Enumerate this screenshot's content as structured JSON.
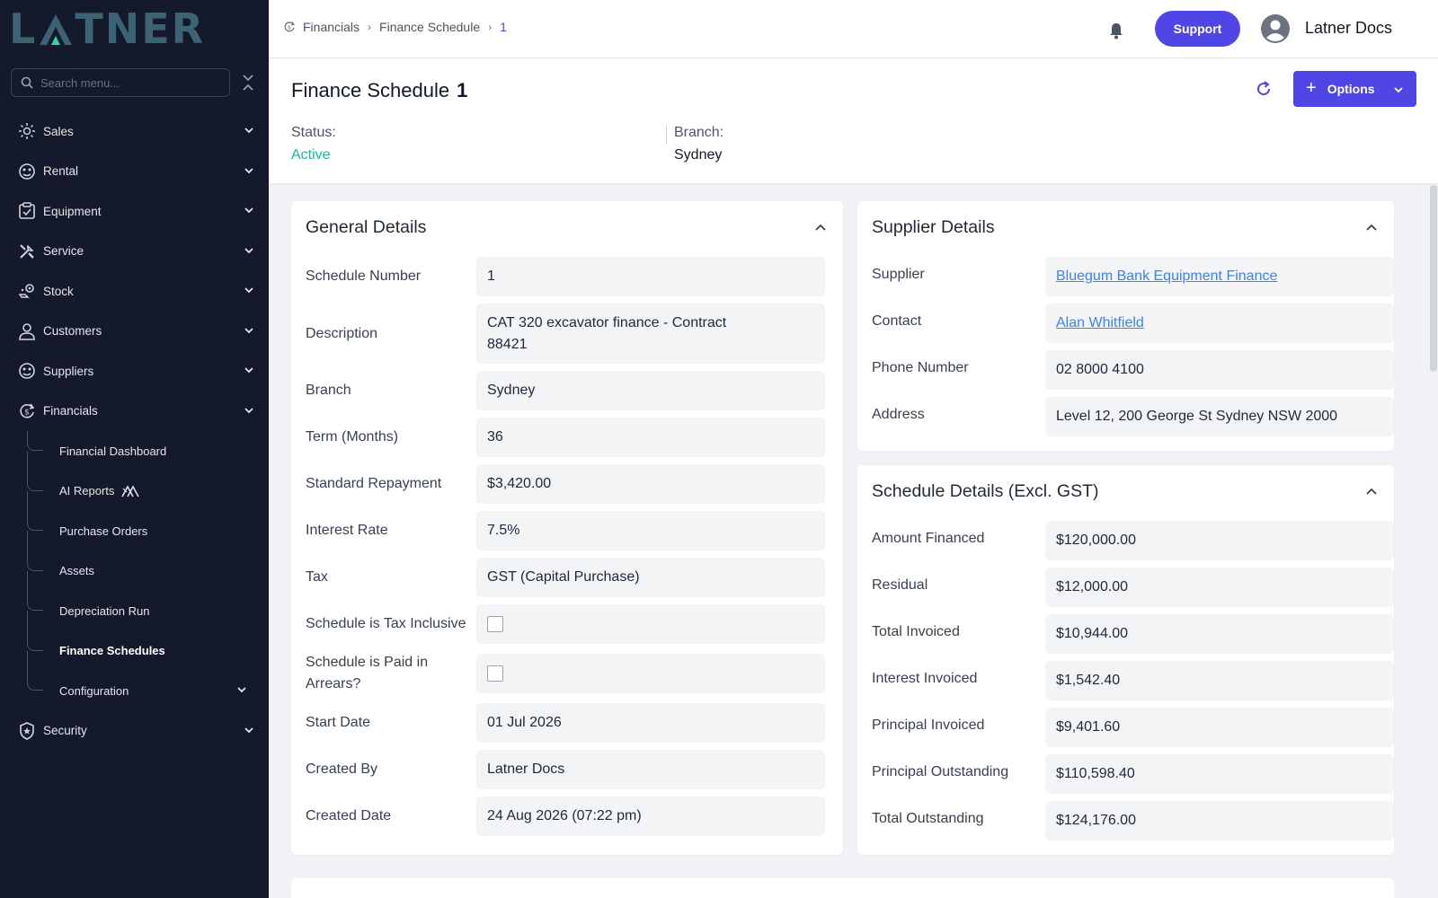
{
  "app": {
    "logo_text": "LATNER"
  },
  "sidebar": {
    "search_placeholder": "Search menu...",
    "items": [
      {
        "label": "Sales",
        "icon": "sales-icon"
      },
      {
        "label": "Rental",
        "icon": "rental-icon"
      },
      {
        "label": "Equipment",
        "icon": "equipment-icon"
      },
      {
        "label": "Service",
        "icon": "service-icon"
      },
      {
        "label": "Stock",
        "icon": "stock-icon"
      },
      {
        "label": "Customers",
        "icon": "customers-icon"
      },
      {
        "label": "Suppliers",
        "icon": "suppliers-icon"
      },
      {
        "label": "Financials",
        "icon": "financials-icon"
      }
    ],
    "financials_sub": [
      {
        "label": "Financial Dashboard"
      },
      {
        "label": "AI Reports"
      },
      {
        "label": "Purchase Orders"
      },
      {
        "label": "Assets"
      },
      {
        "label": "Depreciation Run"
      },
      {
        "label": "Finance Schedules"
      },
      {
        "label": "Configuration"
      }
    ],
    "security": {
      "label": "Security",
      "icon": "security-icon"
    }
  },
  "topbar": {
    "breadcrumb": [
      "Financials",
      "Finance Schedule",
      "1"
    ],
    "support_label": "Support",
    "user_name": "Latner Docs"
  },
  "header": {
    "title": "Finance Schedule",
    "record_number": "1",
    "options_label": "Options",
    "status_label": "Status:",
    "status_value": "Active",
    "branch_label": "Branch:",
    "branch_value": "Sydney"
  },
  "general": {
    "title": "General Details",
    "fields": [
      {
        "label": "Schedule Number",
        "value": "1"
      },
      {
        "label": "Description",
        "value": "CAT 320 excavator finance - Contract 88421"
      },
      {
        "label": "Branch",
        "value": "Sydney"
      },
      {
        "label": "Term (Months)",
        "value": "36"
      },
      {
        "label": "Standard Repayment",
        "value": "$3,420.00"
      },
      {
        "label": "Interest Rate",
        "value": "7.5%"
      },
      {
        "label": "Tax",
        "value": "GST (Capital Purchase)"
      },
      {
        "label": "Schedule is Tax Inclusive",
        "checked": false
      },
      {
        "label": "Schedule is Paid in Arrears?",
        "checked": false
      },
      {
        "label": "Start Date",
        "value": "01 Jul 2026"
      },
      {
        "label": "Created By",
        "value": "Latner Docs"
      },
      {
        "label": "Created Date",
        "value": "24 Aug 2026 (07:22 pm)"
      }
    ]
  },
  "supplier": {
    "title": "Supplier Details",
    "fields": [
      {
        "label": "Supplier",
        "value": "Bluegum Bank Equipment Finance"
      },
      {
        "label": "Contact",
        "value": "Alan Whitfield"
      },
      {
        "label": "Phone Number",
        "value": "02 8000 4100"
      },
      {
        "label": "Address",
        "value": "Level 12, 200 George St Sydney NSW 2000"
      }
    ]
  },
  "schedule": {
    "title": "Schedule Details (Excl. GST)",
    "fields": [
      {
        "label": "Amount Financed",
        "value": "$120,000.00"
      },
      {
        "label": "Residual",
        "value": "$12,000.00"
      },
      {
        "label": "Total Invoiced",
        "value": "$10,944.00"
      },
      {
        "label": "Interest Invoiced",
        "value": "$1,542.40"
      },
      {
        "label": "Principal Invoiced",
        "value": "$9,401.60"
      },
      {
        "label": "Principal Outstanding",
        "value": "$110,598.40"
      },
      {
        "label": "Total Outstanding",
        "value": "$124,176.00"
      }
    ]
  },
  "colors": {
    "accent": "#4f46e5",
    "sidebar_bg": "#14192b",
    "status_active": "#14b8a6",
    "link": "#3b82f6"
  }
}
